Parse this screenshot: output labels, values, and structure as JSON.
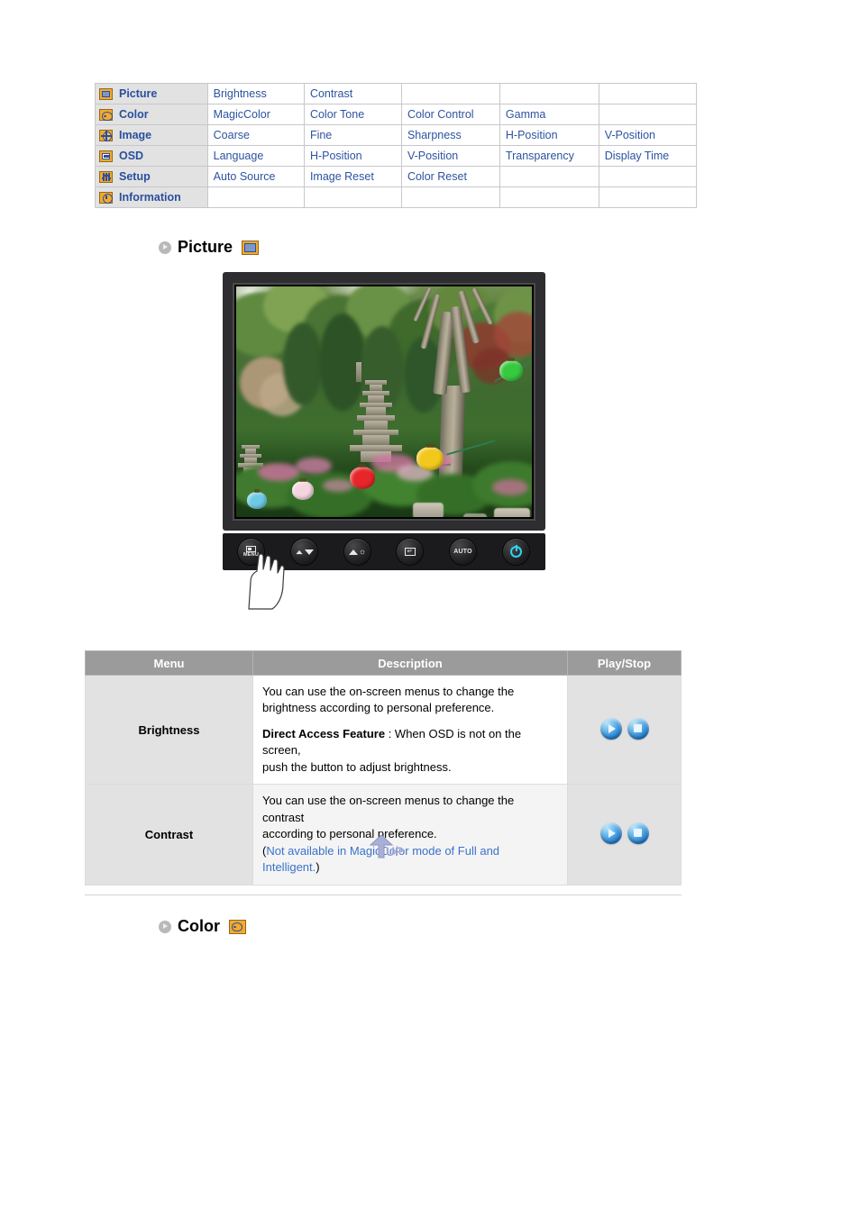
{
  "menu_map": {
    "rows": [
      {
        "icon": "picture-icon",
        "category": "Picture",
        "items": [
          "Brightness",
          "Contrast",
          "",
          "",
          ""
        ]
      },
      {
        "icon": "color-icon",
        "category": "Color",
        "items": [
          "MagicColor",
          "Color Tone",
          "Color Control",
          "Gamma",
          ""
        ]
      },
      {
        "icon": "image-icon",
        "category": "Image",
        "items": [
          "Coarse",
          "Fine",
          "Sharpness",
          "H-Position",
          "V-Position"
        ]
      },
      {
        "icon": "osd-icon",
        "category": "OSD",
        "items": [
          "Language",
          "H-Position",
          "V-Position",
          "Transparency",
          "Display Time"
        ]
      },
      {
        "icon": "setup-icon",
        "category": "Setup",
        "items": [
          "Auto Source",
          "Image Reset",
          "Color Reset",
          "",
          ""
        ]
      },
      {
        "icon": "information-icon",
        "category": "Information",
        "items": [
          "",
          "",
          "",
          "",
          ""
        ]
      }
    ]
  },
  "sections": {
    "picture": {
      "title": "Picture",
      "icon": "picture-icon"
    },
    "color": {
      "title": "Color",
      "icon": "color-icon"
    }
  },
  "monitor": {
    "alt": "Monitor displaying a Korean garden with stone pagodas, trees and colorful paper lanterns",
    "controls": [
      {
        "name": "menu-button",
        "label": "MENU",
        "glyph": "osd-window-icon"
      },
      {
        "name": "down-button",
        "label": "",
        "glyph": "down-arrow-icon"
      },
      {
        "name": "up-brightness-button",
        "label": "",
        "glyph": "up-arrow-brightness-icon"
      },
      {
        "name": "enter-button",
        "label": "",
        "glyph": "enter-icon"
      },
      {
        "name": "auto-button",
        "label": "AUTO",
        "glyph": "auto-text"
      },
      {
        "name": "power-button",
        "label": "",
        "glyph": "power-icon"
      }
    ]
  },
  "desc_table": {
    "headers": [
      "Menu",
      "Description",
      "Play/Stop"
    ],
    "rows": [
      {
        "menu": "Brightness",
        "desc_line1": "You can use the on-screen menus to change the",
        "desc_line2": "brightness according to personal preference.",
        "desc_bold": "Direct Access Feature",
        "desc_line3": " : When OSD is not on the screen,",
        "desc_line4": "push the button to adjust brightness.",
        "play_label": "play-icon",
        "stop_label": "stop-icon"
      },
      {
        "menu": "Contrast",
        "desc_line1": "You can use the on-screen menus to change the contrast",
        "desc_line2": "according to personal preference.",
        "desc_note_open": "(",
        "desc_note": "Not available in MagicColor mode of Full and Intelligent.",
        "desc_note_close": ")",
        "play_label": "play-icon",
        "stop_label": "stop-icon"
      }
    ]
  },
  "up_arrow": {
    "label": "UP"
  },
  "colors": {
    "link_blue": "#2d53a0",
    "note_blue": "#3a72c9",
    "icon_orange": "#f4a92b",
    "header_gray": "#9b9b9b",
    "row_gray": "#e2e2e2"
  }
}
